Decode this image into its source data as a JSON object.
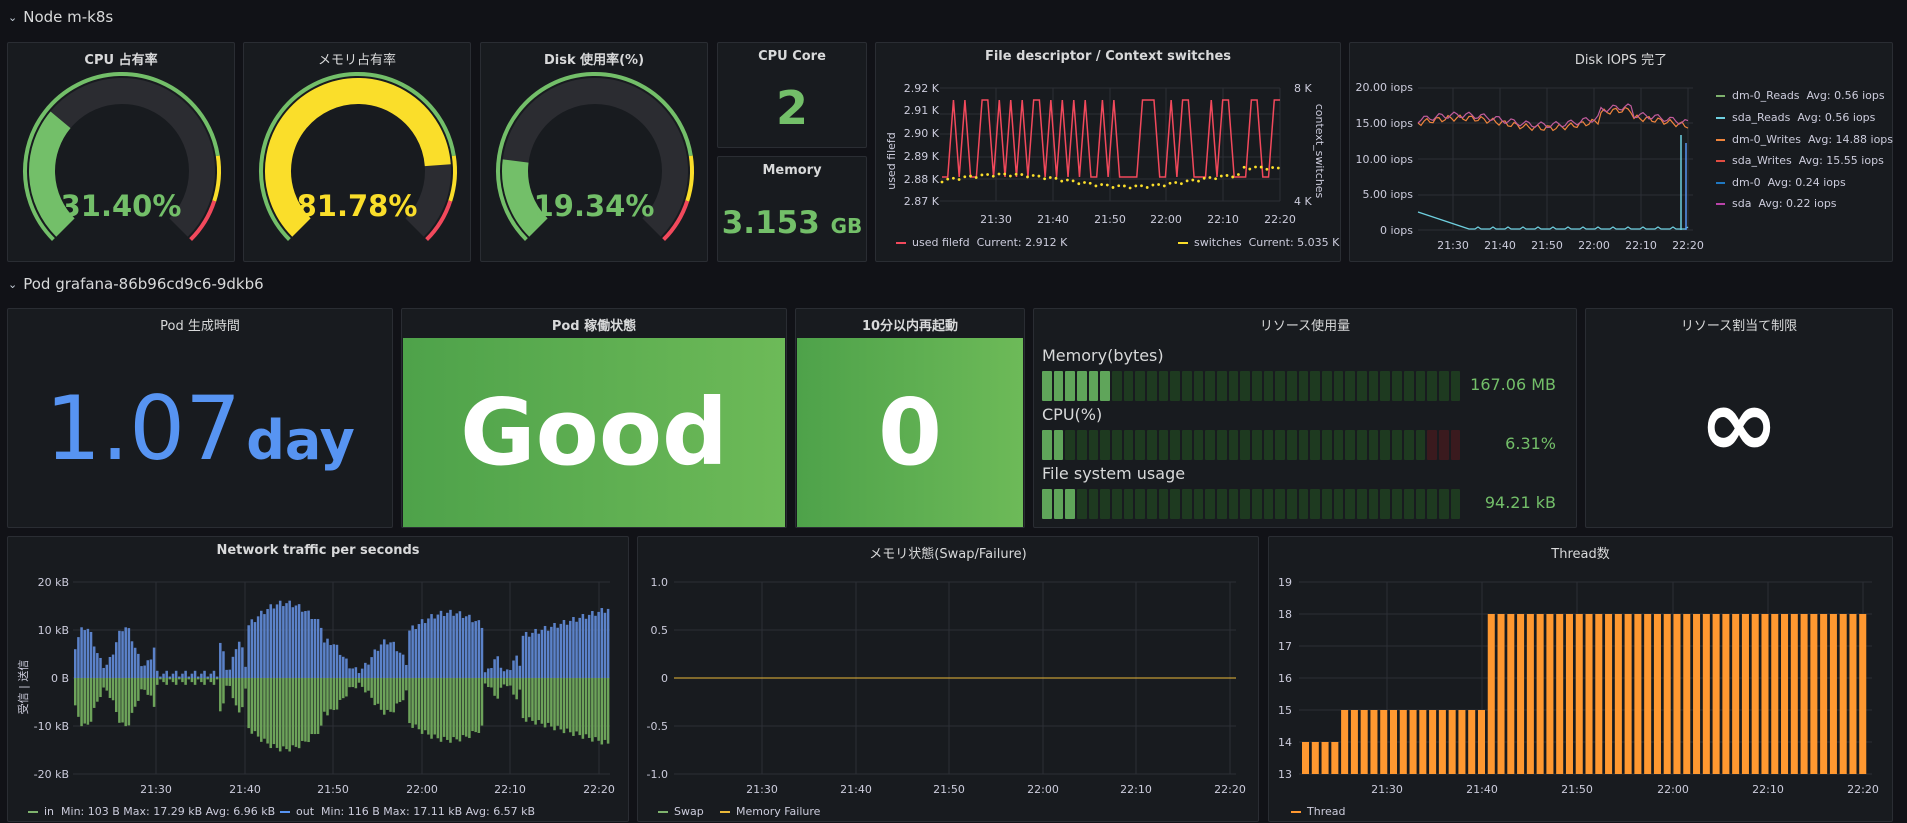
{
  "rows": [
    {
      "title": "Node m-k8s"
    },
    {
      "title": "Pod grafana-86b96cd9c6-9dkb6"
    }
  ],
  "cpu_gauge": {
    "title": "CPU 占有率",
    "value_text": "31.40%",
    "fraction": 0.314,
    "color": "#73bf69"
  },
  "mem_gauge": {
    "title": "メモリ占有率",
    "value_text": "81.78%",
    "fraction": 0.8178,
    "color": "#fade2a"
  },
  "disk_gauge": {
    "title": "Disk 使用率(%)",
    "value_text": "19.34%",
    "fraction": 0.1934,
    "color": "#73bf69"
  },
  "cpu_core": {
    "title": "CPU Core",
    "value": "2"
  },
  "memory": {
    "title": "Memory",
    "value": "3.153",
    "unit": "GB"
  },
  "fd_panel": {
    "title": "File descriptor / Context switches",
    "left_axis_label": "used filefd",
    "right_axis_label": "context_switches",
    "left_ticks": [
      "2.92 K",
      "2.91 K",
      "2.90 K",
      "2.89 K",
      "2.88 K",
      "2.87 K"
    ],
    "right_ticks": [
      "8 K",
      "4 K"
    ],
    "x_ticks": [
      "21:30",
      "21:40",
      "21:50",
      "22:00",
      "22:10",
      "22:20"
    ],
    "legend": [
      {
        "label": "used filefd",
        "stat": "Current: 2.912 K",
        "color": "#f2495c"
      },
      {
        "label": "switches",
        "stat": "Current: 5.035 K",
        "color": "#fade2a"
      }
    ]
  },
  "iops_panel": {
    "title": "Disk IOPS 完了",
    "y_ticks": [
      "20.00 iops",
      "15.00 iops",
      "10.00 iops",
      "5.00 iops",
      "0 iops"
    ],
    "x_ticks": [
      "21:30",
      "21:40",
      "21:50",
      "22:00",
      "22:10",
      "22:20"
    ],
    "legend": [
      {
        "label": "dm-0_Reads",
        "stat": "Avg: 0.56 iops",
        "color": "#7eb26d"
      },
      {
        "label": "sda_Reads",
        "stat": "Avg: 0.56 iops",
        "color": "#6ed0e0"
      },
      {
        "label": "dm-0_Writes",
        "stat": "Avg: 14.88 iops",
        "color": "#ef843c"
      },
      {
        "label": "sda_Writes",
        "stat": "Avg: 15.55 iops",
        "color": "#e24d42"
      },
      {
        "label": "dm-0",
        "stat": "Avg: 0.24 iops",
        "color": "#1f78c1"
      },
      {
        "label": "sda",
        "stat": "Avg: 0.22 iops",
        "color": "#ba43a9"
      }
    ]
  },
  "pod_age": {
    "title": "Pod 生成時間",
    "value": "1.07",
    "unit": "day",
    "color": "#5794f2"
  },
  "pod_status": {
    "title": "Pod 稼働状態",
    "value": "Good"
  },
  "restarts": {
    "title": "10分以内再起動",
    "value": "0"
  },
  "resources": {
    "title": "リソース使用量",
    "items": [
      {
        "label": "Memory(bytes)",
        "value": "167.06 MB",
        "fraction": 0.17
      },
      {
        "label": "CPU(%)",
        "value": "6.31%",
        "fraction": 0.063
      },
      {
        "label": "File system usage",
        "value": "94.21 kB",
        "fraction": 0.09
      }
    ]
  },
  "limits": {
    "title": "リソース割当て制限",
    "value": "∞"
  },
  "network": {
    "title": "Network traffic per seconds",
    "axis_label": "受信 | 送信",
    "y_ticks": [
      "20 kB",
      "10 kB",
      "0 B",
      "-10 kB",
      "-20 kB"
    ],
    "x_ticks": [
      "21:30",
      "21:40",
      "21:50",
      "22:00",
      "22:10",
      "22:20"
    ],
    "legend": [
      {
        "label": "in",
        "stat": "Min: 103 B  Max: 17.29 kB  Avg: 6.96 kB",
        "color": "#7eb26d"
      },
      {
        "label": "out",
        "stat": "Min: 116 B  Max: 17.11 kB  Avg: 6.57 kB",
        "color": "#5794f2"
      }
    ]
  },
  "mem_state": {
    "title": "メモリ状態(Swap/Failure)",
    "y_ticks": [
      "1.0",
      "0.5",
      "0",
      "-0.5",
      "-1.0"
    ],
    "x_ticks": [
      "21:30",
      "21:40",
      "21:50",
      "22:00",
      "22:10",
      "22:20"
    ],
    "legend": [
      {
        "label": "Swap",
        "color": "#7eb26d"
      },
      {
        "label": "Memory Failure",
        "color": "#eab839"
      }
    ]
  },
  "threads": {
    "title": "Thread数",
    "y_ticks": [
      "19",
      "18",
      "17",
      "16",
      "15",
      "14",
      "13"
    ],
    "x_ticks": [
      "21:30",
      "21:40",
      "21:50",
      "22:00",
      "22:10",
      "22:20"
    ],
    "legend": [
      {
        "label": "Thread",
        "color": "#ff9830"
      }
    ],
    "values": [
      14,
      14,
      14,
      14,
      15,
      15,
      15,
      15,
      15,
      15,
      15,
      15,
      15,
      15,
      15,
      15,
      15,
      15,
      15,
      18,
      18,
      18,
      18,
      18,
      18,
      18,
      18,
      18,
      18,
      18,
      18,
      18,
      18,
      18,
      18,
      18,
      18,
      18,
      18,
      18,
      18,
      18,
      18,
      18,
      18,
      18,
      18,
      18,
      18,
      18,
      18,
      18,
      18,
      18,
      18,
      18,
      18,
      18
    ]
  }
}
